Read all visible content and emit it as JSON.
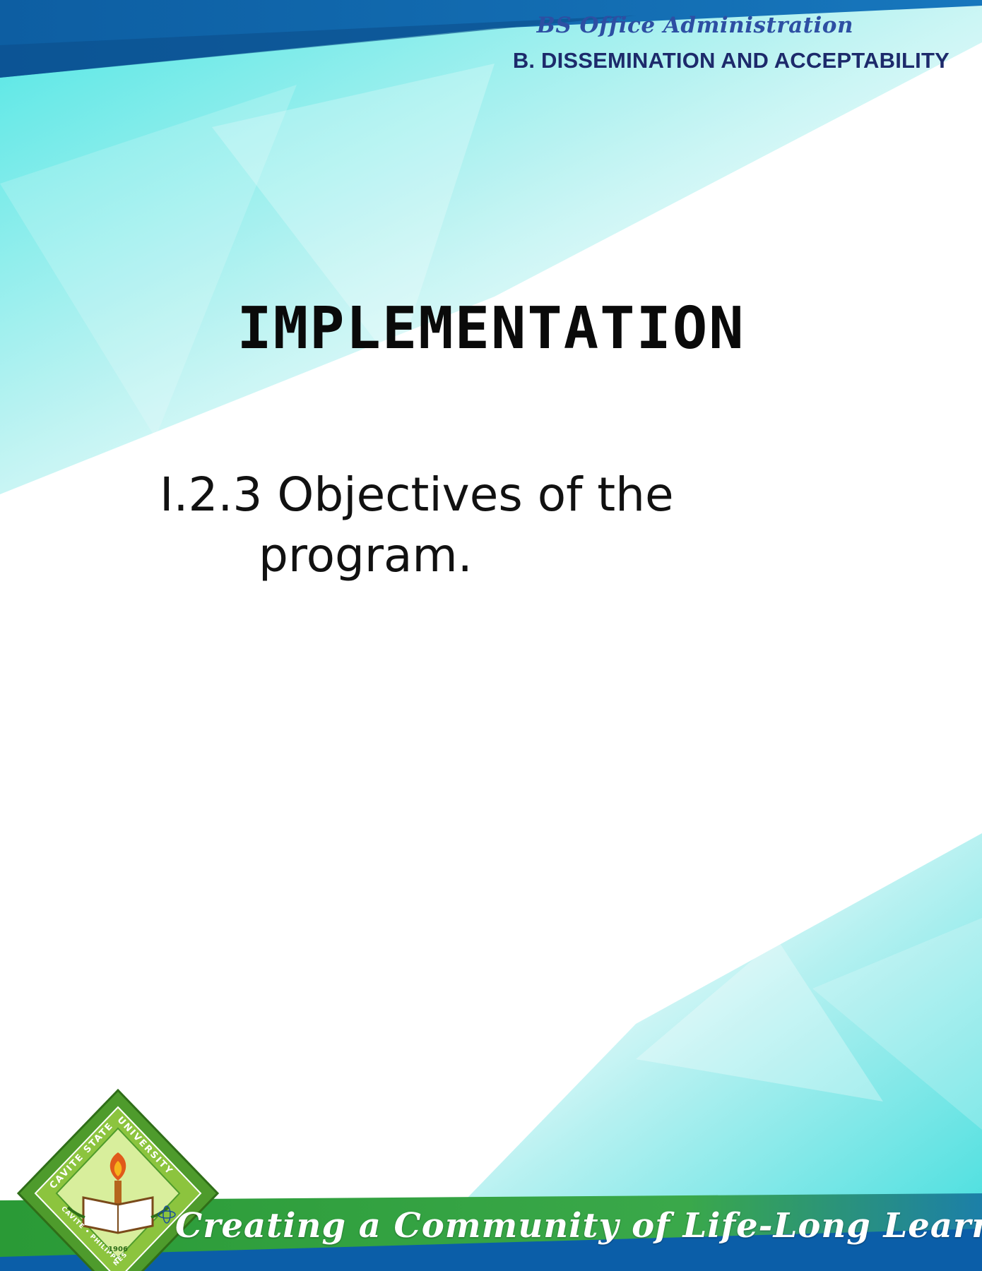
{
  "header": {
    "program": "BS Office Administration",
    "section": "B. DISSEMINATION AND ACCEPTABILITY"
  },
  "main": {
    "title": "IMPLEMENTATION",
    "objective_line1": "I.2.3 Objectives of the",
    "objective_line2": "program."
  },
  "footer": {
    "motto": "Creating a Community of Life-Long Learners"
  },
  "logo": {
    "name": "Cavite State University seal",
    "ring_top": "CAVITE STATE UNIVERSITY",
    "ring_bottom": "CAVITE • PHILIPPINES",
    "year": "1906"
  },
  "colors": {
    "header_band": "#0f63a8",
    "header_text": "#1d2a6b",
    "program_text": "#2d4fa3",
    "teal": "#4fe0df",
    "footer_green": "#2e9d3a",
    "footer_blue": "#0b5ea8",
    "seal_green": "#5fa833"
  }
}
